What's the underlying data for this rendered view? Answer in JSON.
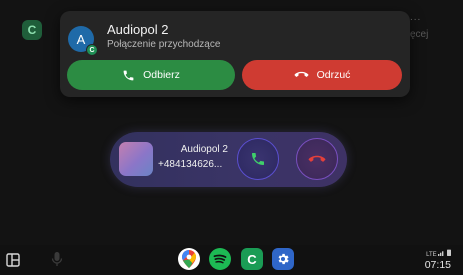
{
  "background": {
    "app_icon_letter": "C",
    "more_dots": "...",
    "partial_text": "ęcej"
  },
  "notification": {
    "avatar_letter": "A",
    "badge_letter": "C",
    "title": "Audiopol 2",
    "subtitle": "Połączenie przychodzące",
    "answer_label": "Odbierz",
    "decline_label": "Odrzuć",
    "colors": {
      "answer": "#2c8c43",
      "decline": "#cf3b32"
    }
  },
  "call_pill": {
    "caller_name": "Audiopol  2",
    "caller_number": "+484134626..."
  },
  "taskbar": {
    "phone_letter": "C",
    "signal": "LTE",
    "clock": "07:15"
  }
}
